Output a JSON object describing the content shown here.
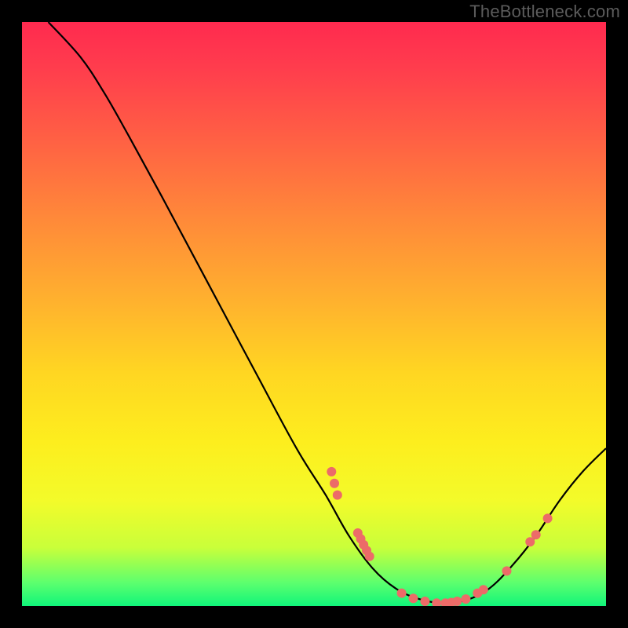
{
  "watermark": "TheBottleneck.com",
  "chart_data": {
    "type": "line",
    "title": "",
    "xlabel": "",
    "ylabel": "",
    "xlim": [
      0,
      1
    ],
    "ylim": [
      0,
      1
    ],
    "curve": [
      {
        "x": 0.045,
        "y": 1.0
      },
      {
        "x": 0.1,
        "y": 0.94
      },
      {
        "x": 0.14,
        "y": 0.88
      },
      {
        "x": 0.18,
        "y": 0.81
      },
      {
        "x": 0.24,
        "y": 0.7
      },
      {
        "x": 0.32,
        "y": 0.55
      },
      {
        "x": 0.4,
        "y": 0.4
      },
      {
        "x": 0.47,
        "y": 0.27
      },
      {
        "x": 0.52,
        "y": 0.19
      },
      {
        "x": 0.56,
        "y": 0.12
      },
      {
        "x": 0.6,
        "y": 0.065
      },
      {
        "x": 0.64,
        "y": 0.03
      },
      {
        "x": 0.68,
        "y": 0.012
      },
      {
        "x": 0.72,
        "y": 0.005
      },
      {
        "x": 0.76,
        "y": 0.01
      },
      {
        "x": 0.8,
        "y": 0.03
      },
      {
        "x": 0.84,
        "y": 0.07
      },
      {
        "x": 0.88,
        "y": 0.12
      },
      {
        "x": 0.92,
        "y": 0.18
      },
      {
        "x": 0.96,
        "y": 0.23
      },
      {
        "x": 1.0,
        "y": 0.27
      }
    ],
    "markers": [
      {
        "x": 0.53,
        "y": 0.23
      },
      {
        "x": 0.535,
        "y": 0.21
      },
      {
        "x": 0.54,
        "y": 0.19
      },
      {
        "x": 0.575,
        "y": 0.125
      },
      {
        "x": 0.58,
        "y": 0.115
      },
      {
        "x": 0.585,
        "y": 0.105
      },
      {
        "x": 0.59,
        "y": 0.095
      },
      {
        "x": 0.595,
        "y": 0.085
      },
      {
        "x": 0.65,
        "y": 0.022
      },
      {
        "x": 0.67,
        "y": 0.013
      },
      {
        "x": 0.69,
        "y": 0.008
      },
      {
        "x": 0.71,
        "y": 0.005
      },
      {
        "x": 0.725,
        "y": 0.005
      },
      {
        "x": 0.735,
        "y": 0.006
      },
      {
        "x": 0.745,
        "y": 0.008
      },
      {
        "x": 0.76,
        "y": 0.012
      },
      {
        "x": 0.78,
        "y": 0.022
      },
      {
        "x": 0.79,
        "y": 0.028
      },
      {
        "x": 0.83,
        "y": 0.06
      },
      {
        "x": 0.87,
        "y": 0.11
      },
      {
        "x": 0.88,
        "y": 0.122
      },
      {
        "x": 0.9,
        "y": 0.15
      }
    ],
    "marker_color": "#ec6b68",
    "gradient_stops": [
      {
        "pos": 0.0,
        "color": "#ff2a4f"
      },
      {
        "pos": 0.5,
        "color": "#ffd622"
      },
      {
        "pos": 1.0,
        "color": "#10f57a"
      }
    ]
  }
}
